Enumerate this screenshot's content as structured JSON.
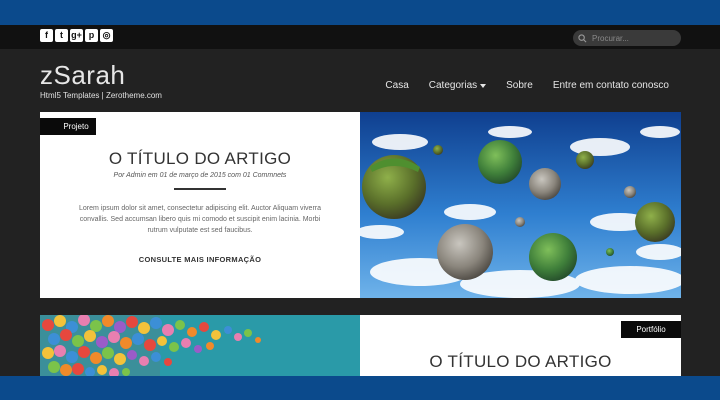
{
  "social": [
    {
      "icon": "facebook-icon",
      "glyph": "f"
    },
    {
      "icon": "twitter-icon",
      "glyph": "t"
    },
    {
      "icon": "google-plus-icon",
      "glyph": "g+"
    },
    {
      "icon": "pinterest-icon",
      "glyph": "p"
    },
    {
      "icon": "instagram-icon",
      "glyph": "◎"
    }
  ],
  "search": {
    "placeholder": "Procurar..."
  },
  "brand": {
    "title": "zSarah",
    "tagline": "Html5 Templates | Zerotheme.com"
  },
  "nav": {
    "items": [
      {
        "label": "Casa"
      },
      {
        "label": "Categorias",
        "has_dropdown": true
      },
      {
        "label": "Sobre"
      },
      {
        "label": "Entre em contato conosco"
      }
    ]
  },
  "posts": [
    {
      "tag": "Projeto",
      "title": "O TÍTULO DO ARTIGO",
      "meta": "Por Admin em 01 de março de 2015 com 01 Commnets",
      "excerpt": "Lorem ipsum dolor sit amet, consectetur adipiscing elit. Auctor Aliquam viverra convallis. Sed accumsan libero quis mi comodo et suscipit enim lacinia. Morbi rutrum vulputate est sed faucibus.",
      "more": "CONSULTE MAIS INFORMAÇÃO"
    },
    {
      "tag": "Portfólio",
      "title": "O TÍTULO DO ARTIGO"
    }
  ],
  "colors": {
    "frame": "#0b4a8c",
    "topbar": "#111111",
    "page": "#222222",
    "card": "#ffffff",
    "tag": "#0a0a0a"
  }
}
